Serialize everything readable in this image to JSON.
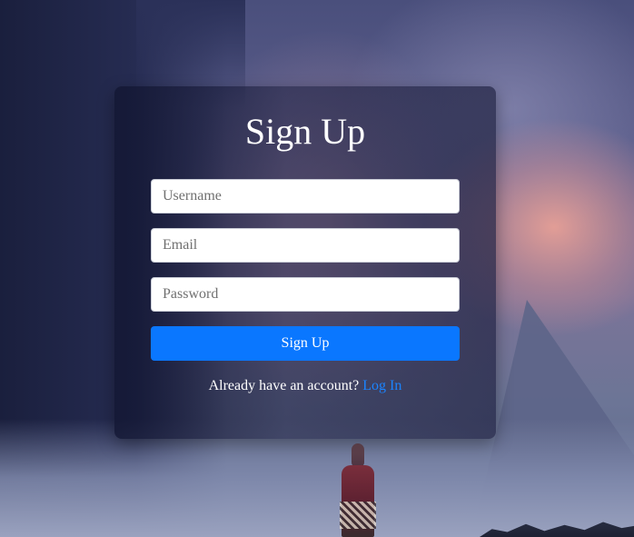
{
  "signup": {
    "title": "Sign Up",
    "username_placeholder": "Username",
    "email_placeholder": "Email",
    "password_placeholder": "Password",
    "submit_label": "Sign Up",
    "login_prompt": "Already have an account?",
    "login_link": "Log In"
  },
  "colors": {
    "accent": "#0a77ff",
    "link": "#1b84ff",
    "card_background": "#1c2040"
  }
}
